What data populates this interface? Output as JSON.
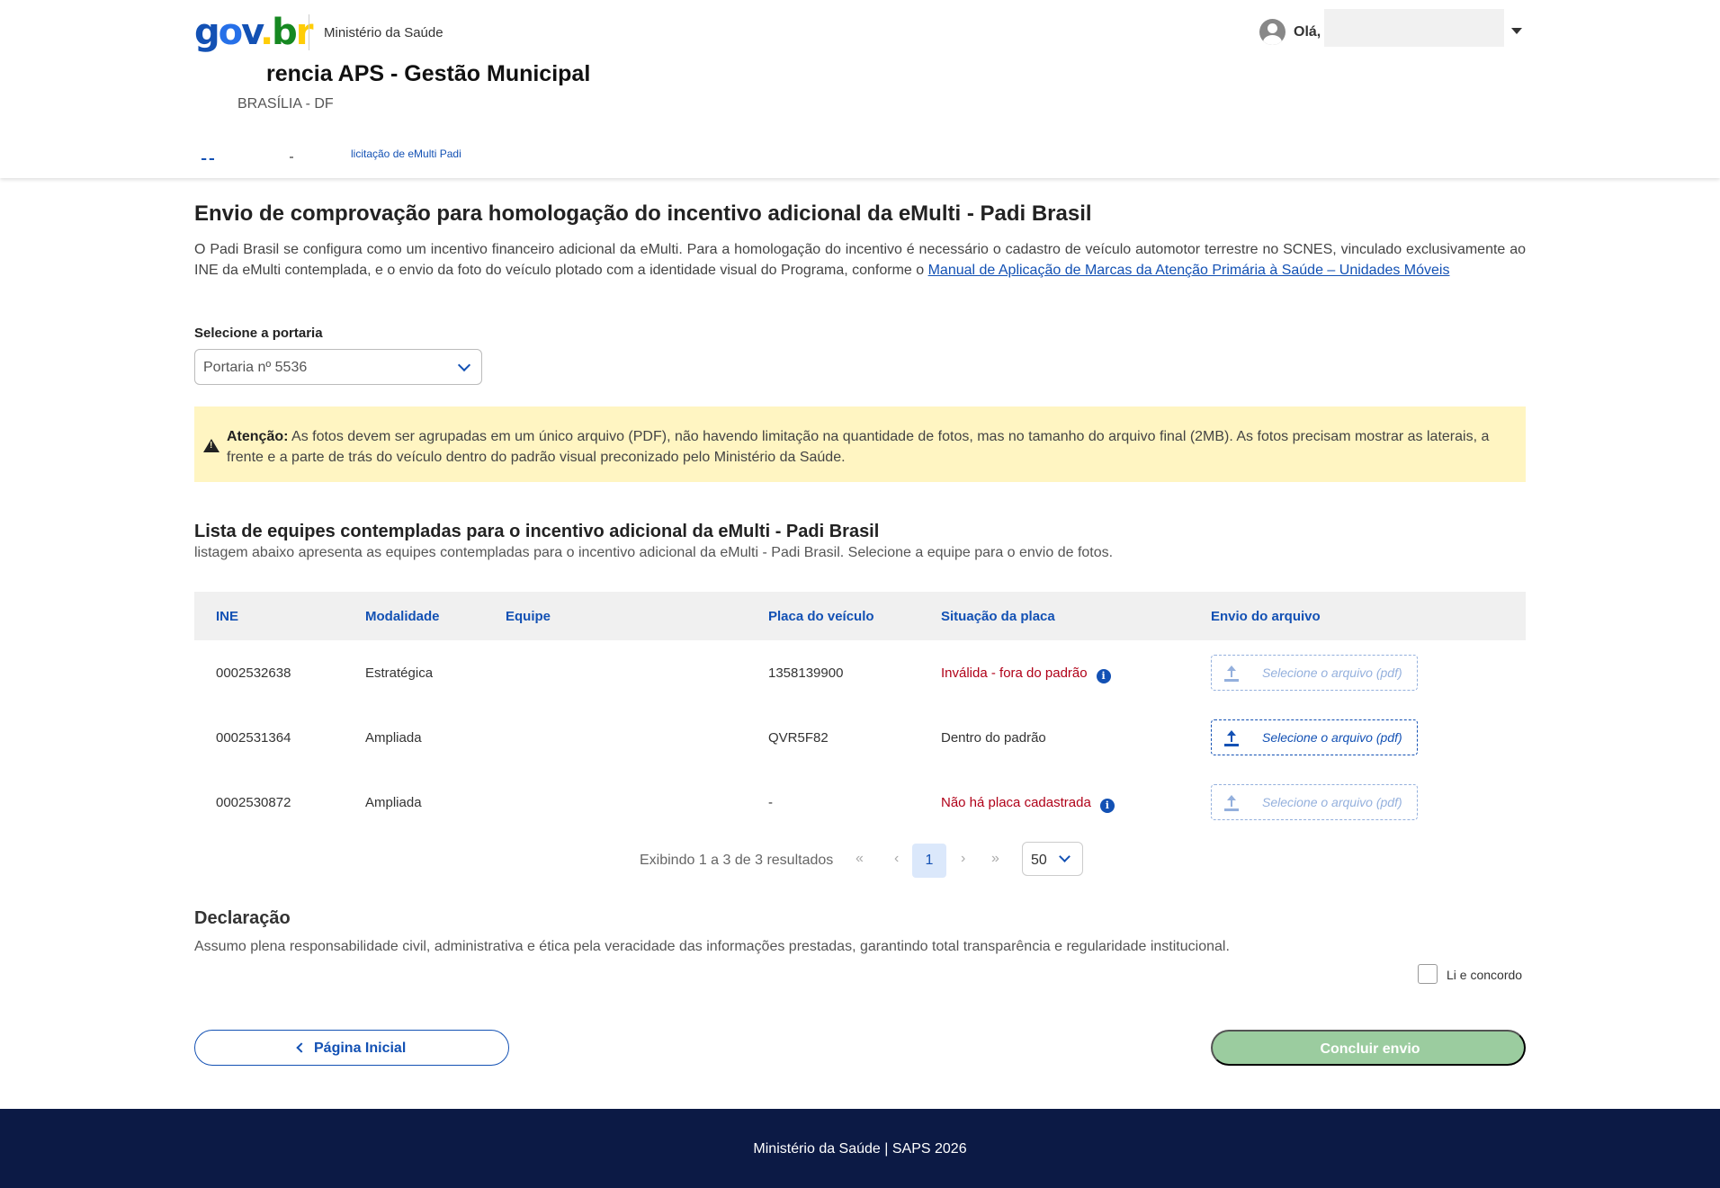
{
  "header": {
    "logo_parts": [
      "g",
      "o",
      "v",
      ".",
      "b",
      "r"
    ],
    "ministry": "Ministério da Saúde",
    "greeting": "Olá,",
    "system_title": "rencia APS - Gestão Municipal",
    "location": "BRASÍLIA - DF",
    "breadcrumb": "licitação de eMulti Padi"
  },
  "page": {
    "title": "Envio de comprovação para homologação do incentivo adicional da eMulti - Padi Brasil",
    "intro_text": "O Padi Brasil se configura como um incentivo financeiro adicional da eMulti. Para a homologação do incentivo é necessário o cadastro de veículo automotor terrestre no SCNES, vinculado exclusivamente ao INE da eMulti contemplada, e o envio da foto do veículo plotado com a identidade visual do Programa, conforme o ",
    "intro_link": "Manual de Aplicação de Marcas da Atenção Primária à Saúde – Unidades Móveis"
  },
  "portaria": {
    "label": "Selecione a portaria",
    "value": "Portaria nº 5536"
  },
  "alert": {
    "bold": "Atenção:",
    "text": " As fotos devem ser agrupadas em um único arquivo (PDF), não havendo limitação na quantidade de fotos, mas no tamanho do arquivo final (2MB). As fotos precisam mostrar as laterais, a frente e a parte de trás do veículo dentro do padrão visual preconizado pelo Ministério da Saúde."
  },
  "list": {
    "title": "Lista de equipes contempladas para o incentivo adicional da eMulti - Padi Brasil",
    "subtitle": "listagem abaixo apresenta as equipes contempladas para o incentivo adicional da eMulti - Padi Brasil. Selecione a equipe para o envio de fotos."
  },
  "table": {
    "headers": [
      "INE",
      "Modalidade",
      "Equipe",
      "Placa do veículo",
      "Situação da placa",
      "Envio do arquivo"
    ],
    "rows": [
      {
        "ine": "0002532638",
        "modalidade": "Estratégica",
        "equipe": "",
        "placa": "1358139900",
        "situacao": "Inválida - fora do padrão",
        "status": "invalid",
        "upload": "Selecione o arquivo (pdf)",
        "upload_enabled": false
      },
      {
        "ine": "0002531364",
        "modalidade": "Ampliada",
        "equipe": "",
        "placa": "QVR5F82",
        "situacao": "Dentro do padrão",
        "status": "valid",
        "upload": "Selecione o arquivo (pdf)",
        "upload_enabled": true
      },
      {
        "ine": "0002530872",
        "modalidade": "Ampliada",
        "equipe": "",
        "placa": "-",
        "situacao": "Não há placa cadastrada",
        "status": "invalid",
        "upload": "Selecione o arquivo (pdf)",
        "upload_enabled": false
      }
    ]
  },
  "pagination": {
    "info": "Exibindo 1 a 3 de 3 resultados",
    "first": "«",
    "prev": "‹",
    "current_page": "1",
    "next": "›",
    "last": "»",
    "page_size": "50"
  },
  "declaration": {
    "title": "Declaração",
    "text": "Assumo plena responsabilidade civil, administrativa e ética pela veracidade das informações prestadas, garantindo total transparência e regularidade institucional.",
    "agree_label": "Li e concordo",
    "agreed": false
  },
  "actions": {
    "home_label": "Página Inicial",
    "submit_label": "Concluir envio"
  },
  "footer": {
    "text": "Ministério da Saúde | SAPS 2026"
  },
  "colors": {
    "primary": "#1351b4",
    "invalid": "#b00018",
    "alert_bg": "#fff5c2",
    "submit_disabled": "#9bcc9f",
    "footer_bg": "#0c1a45"
  }
}
